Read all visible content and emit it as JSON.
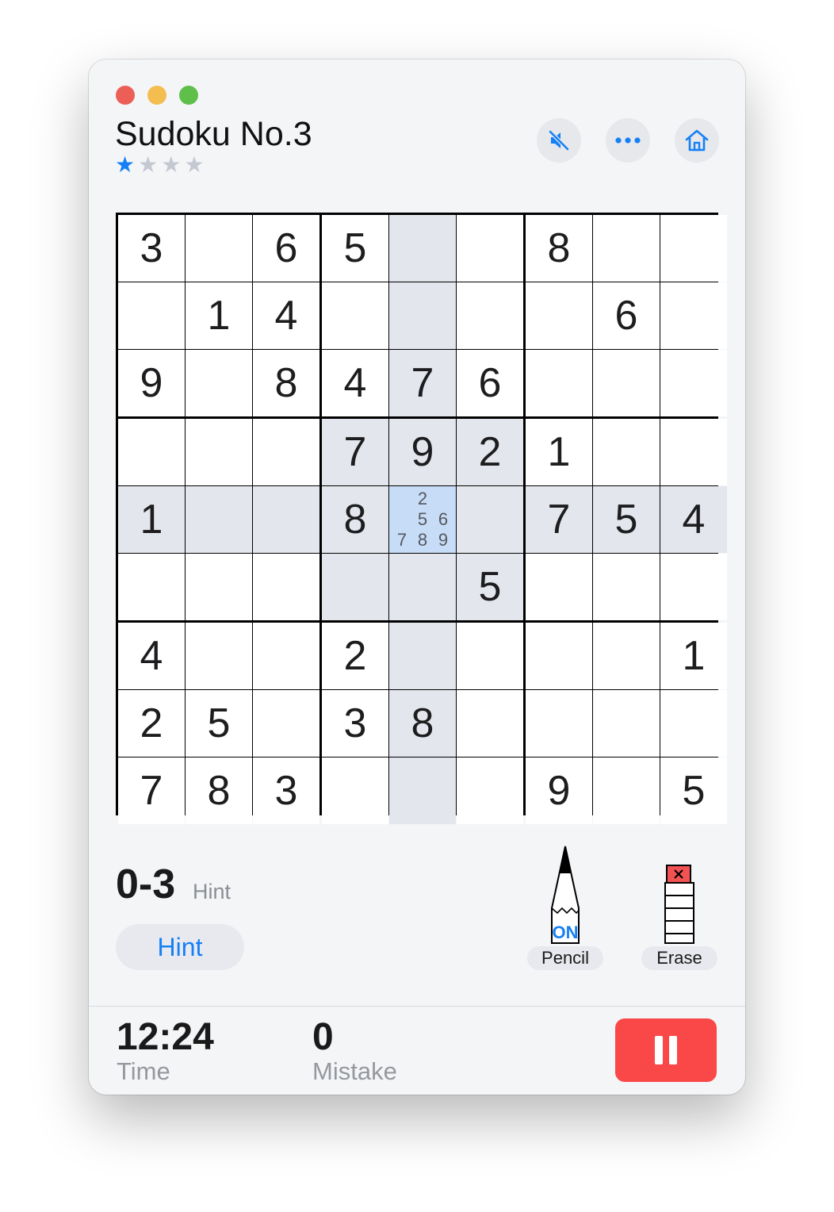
{
  "window": {
    "title": "Sudoku No.3",
    "difficulty_stars": {
      "filled": 1,
      "total": 4
    }
  },
  "toolbar": {
    "mute_icon": "speaker-muted-icon",
    "more_icon": "ellipsis-icon",
    "home_icon": "house-icon"
  },
  "board": {
    "rows": [
      [
        "3",
        "",
        "6",
        "5",
        "",
        "",
        "8",
        "",
        ""
      ],
      [
        "",
        "1",
        "4",
        "",
        "",
        "",
        "",
        "6",
        ""
      ],
      [
        "9",
        "",
        "8",
        "4",
        "7",
        "6",
        "",
        "",
        ""
      ],
      [
        "",
        "",
        "",
        "7",
        "9",
        "2",
        "1",
        "",
        ""
      ],
      [
        "1",
        "",
        "",
        "8",
        "",
        "",
        "7",
        "5",
        "4"
      ],
      [
        "",
        "",
        "",
        "",
        "",
        "5",
        "",
        "",
        ""
      ],
      [
        "4",
        "",
        "",
        "2",
        "",
        "",
        "",
        "",
        "1"
      ],
      [
        "2",
        "5",
        "",
        "3",
        "8",
        "",
        "",
        "",
        ""
      ],
      [
        "7",
        "8",
        "3",
        "",
        "",
        "",
        "9",
        "",
        "5"
      ]
    ],
    "selected_cell": {
      "row": 4,
      "col": 4
    },
    "selected_notes": [
      "",
      "2",
      "",
      "",
      "5",
      "6",
      "7",
      "8",
      "9"
    ]
  },
  "hints": {
    "count": "0-3",
    "count_label": "Hint",
    "button_label": "Hint"
  },
  "tools": {
    "pencil_label": "Pencil",
    "pencil_state": "ON",
    "erase_label": "Erase"
  },
  "stats": {
    "time": "12:24",
    "time_label": "Time",
    "mistakes": "0",
    "mistakes_label": "Mistake"
  },
  "colors": {
    "accent": "#1580f5",
    "highlight": "#e3e6ec",
    "selected": "#c7dcf6",
    "pause": "#fa4848"
  }
}
